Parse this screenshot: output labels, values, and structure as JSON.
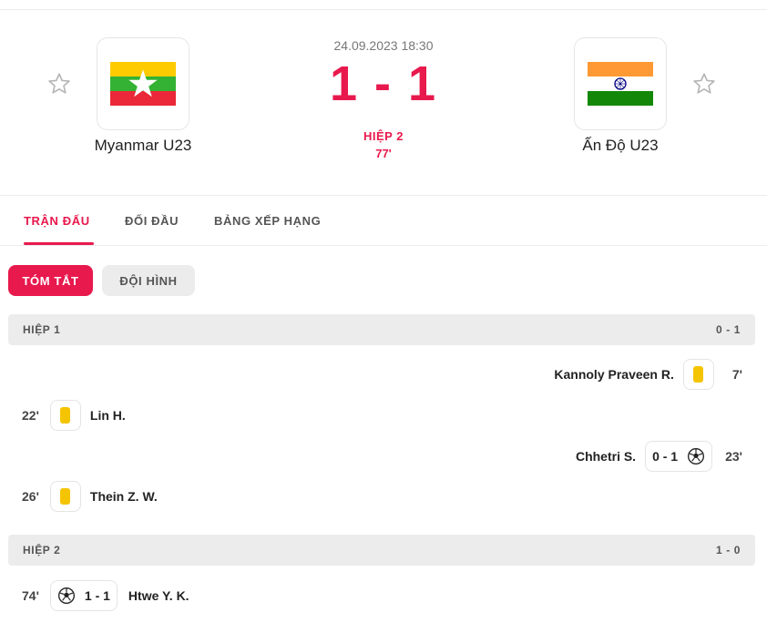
{
  "match": {
    "datetime": "24.09.2023 18:30",
    "score": "1 - 1",
    "period": "HIỆP 2",
    "minute": "77'"
  },
  "home": {
    "name": "Myanmar U23",
    "flag": "myanmar-flag",
    "star": "star-outline-icon"
  },
  "away": {
    "name": "Ấn Độ U23",
    "flag": "india-flag",
    "star": "star-outline-icon"
  },
  "tabs": [
    {
      "label": "TRẬN ĐẤU",
      "active": true
    },
    {
      "label": "ĐỐI ĐẦU",
      "active": false
    },
    {
      "label": "BẢNG XẾP HẠNG",
      "active": false
    }
  ],
  "subtabs": [
    {
      "label": "TÓM TẮT",
      "active": true
    },
    {
      "label": "ĐỘI HÌNH",
      "active": false
    }
  ],
  "sections": [
    {
      "title": "HIỆP 1",
      "score": "0 - 1",
      "events": [
        {
          "side": "away",
          "minute": "7'",
          "player": "Kannoly Praveen R.",
          "type": "yellow-card"
        },
        {
          "side": "home",
          "minute": "22'",
          "player": "Lin H.",
          "type": "yellow-card"
        },
        {
          "side": "away",
          "minute": "23'",
          "player": "Chhetri S.",
          "type": "goal",
          "score": "0 - 1"
        },
        {
          "side": "home",
          "minute": "26'",
          "player": "Thein Z. W.",
          "type": "yellow-card"
        }
      ]
    },
    {
      "title": "HIỆP 2",
      "score": "1 - 0",
      "events": [
        {
          "side": "home",
          "minute": "74'",
          "player": "Htwe Y. K.",
          "type": "goal",
          "score": "1 - 1"
        }
      ]
    }
  ],
  "colors": {
    "accent": "#e8194d",
    "yellow_card": "#f5c400",
    "section_bg": "#ececec"
  }
}
